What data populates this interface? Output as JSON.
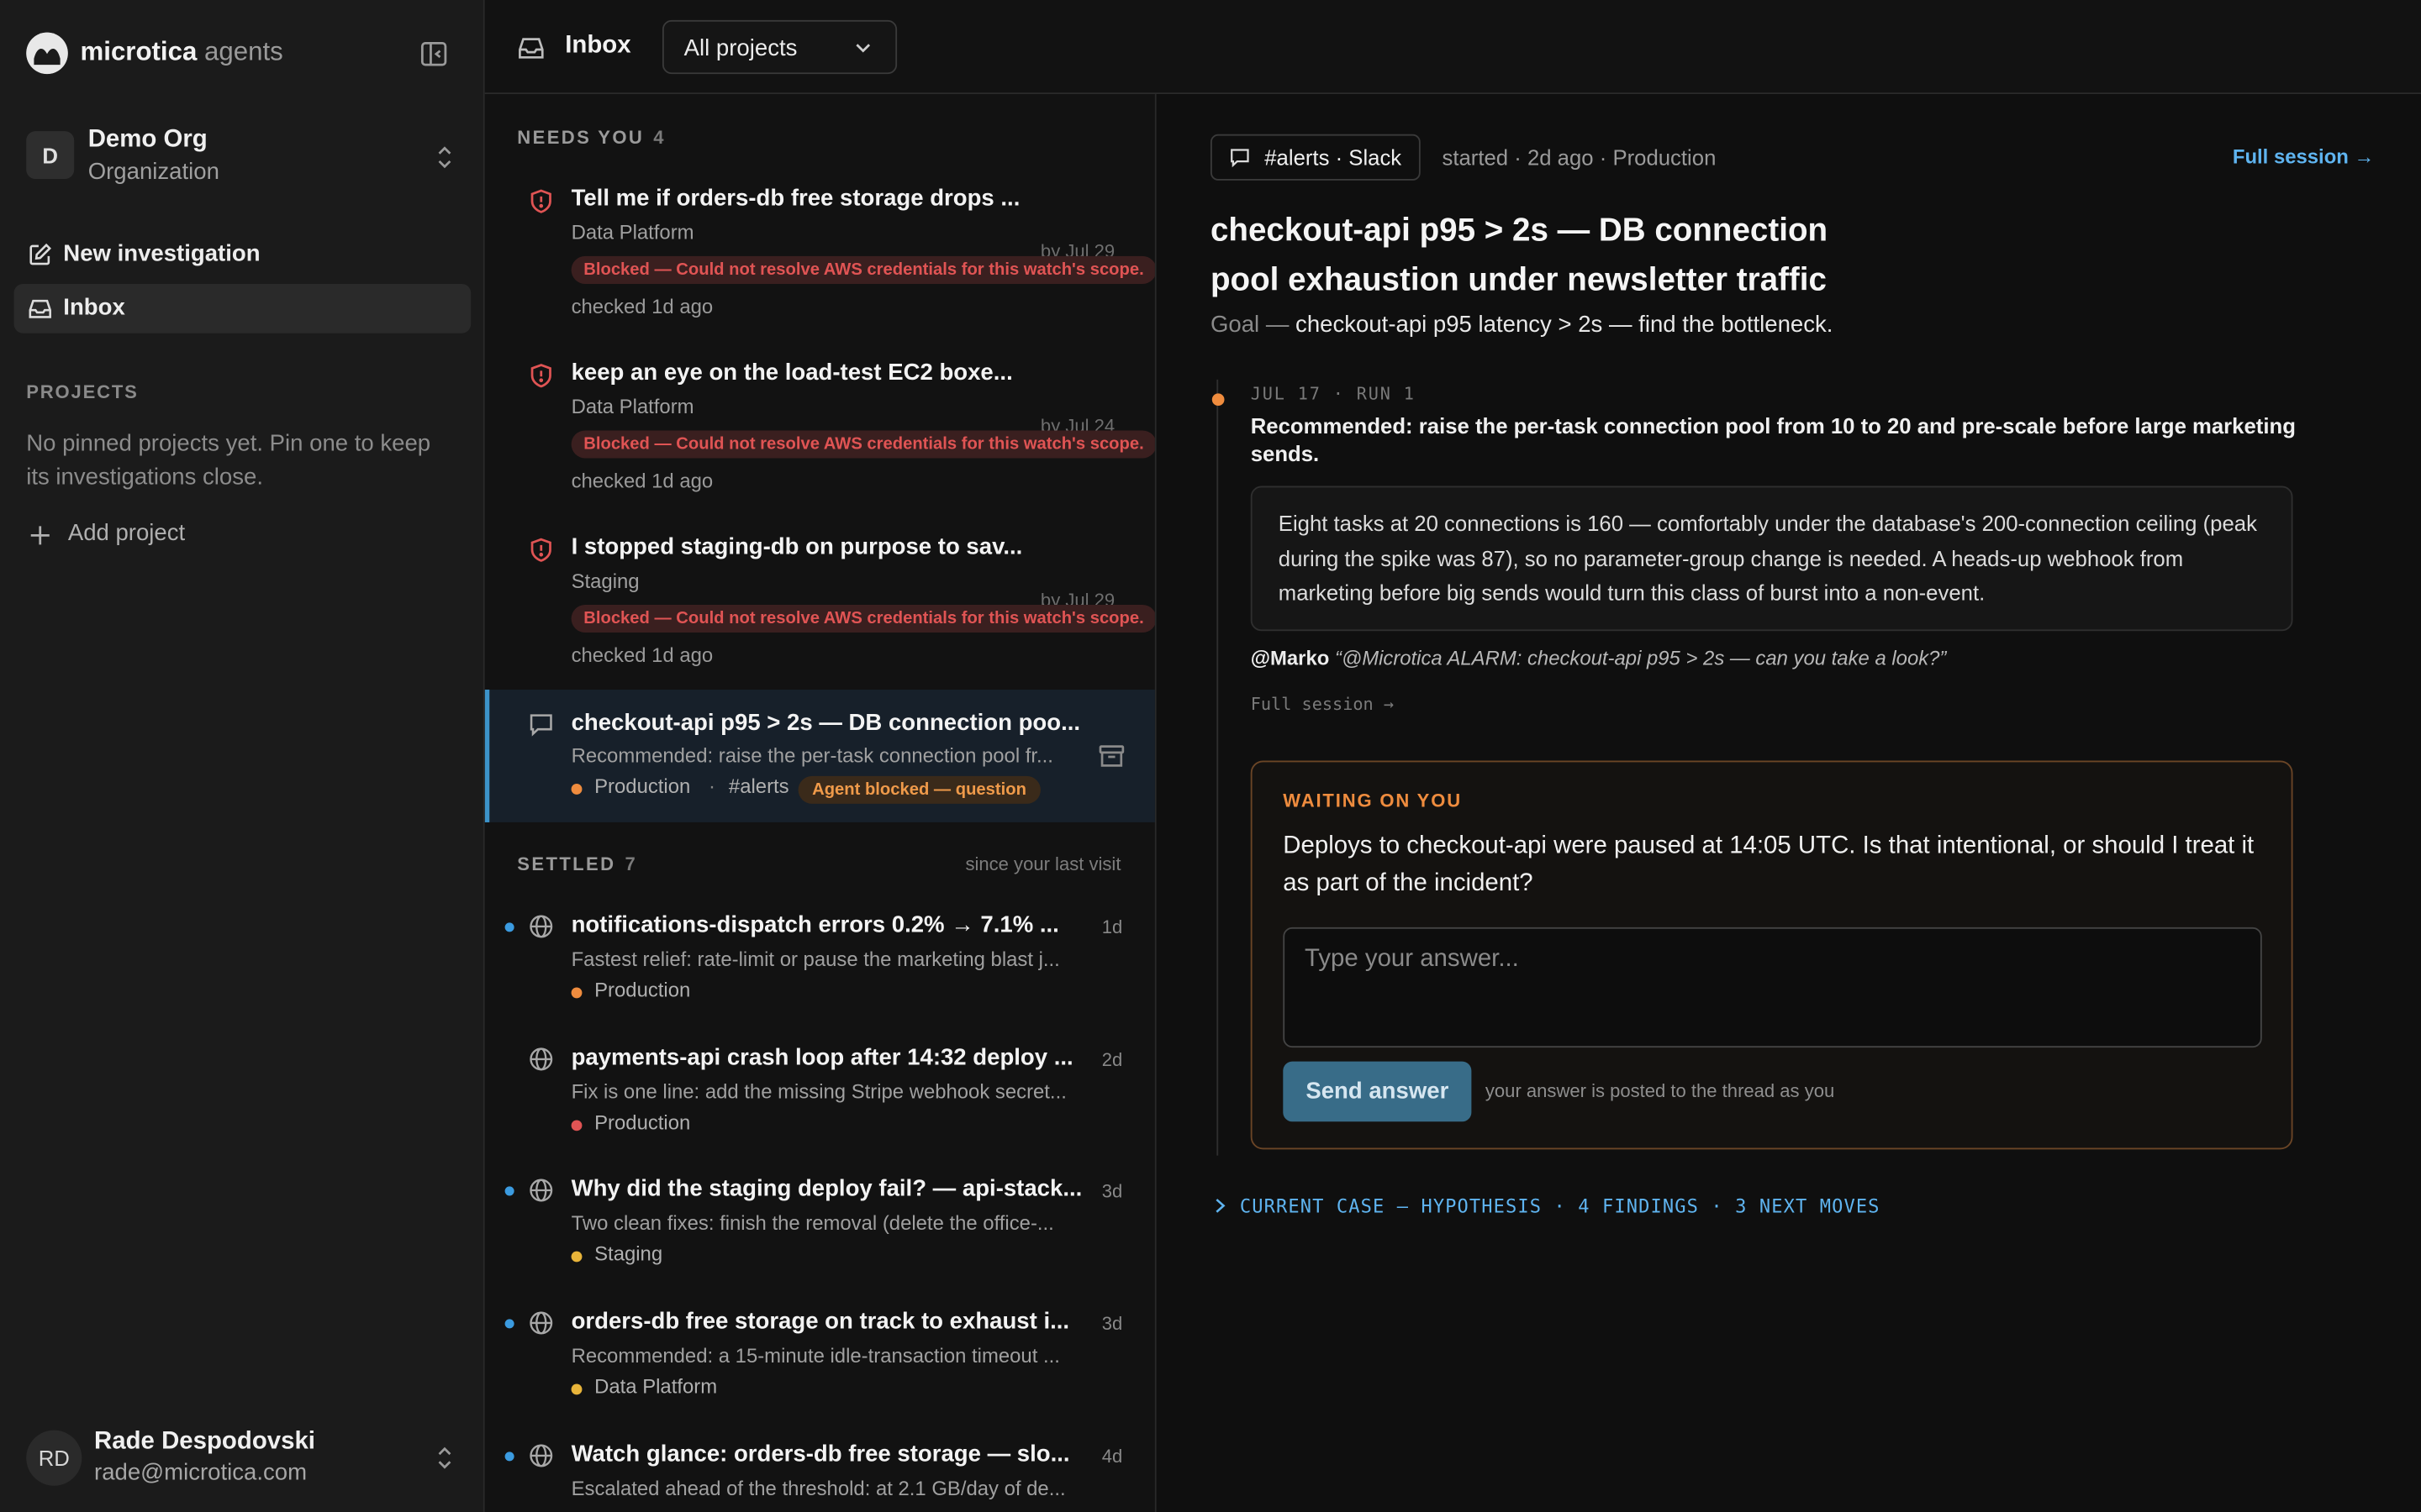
{
  "app": {
    "brand": "microtica",
    "brand_sub": "agents"
  },
  "org": {
    "initial": "D",
    "name": "Demo Org",
    "type": "Organization"
  },
  "nav": {
    "new_investigation": "New investigation",
    "inbox": "Inbox"
  },
  "projects": {
    "label": "PROJECTS",
    "empty": "No pinned projects yet. Pin one to keep its investigations close.",
    "add": "Add project"
  },
  "user": {
    "initials": "RD",
    "name": "Rade Despodovski",
    "email": "rade@microtica.com"
  },
  "topbar": {
    "title": "Inbox",
    "project_filter": "All projects"
  },
  "needs_you": {
    "label": "NEEDS YOU",
    "count": "4",
    "items": [
      {
        "title": "Tell me if orders-db free storage drops ...",
        "sub": "Data Platform",
        "by": "by Jul 29",
        "blocked": "Blocked — Could not resolve AWS credentials for this watch's scope.",
        "checked": "checked 1d ago"
      },
      {
        "title": "keep an eye on the load-test EC2 boxe...",
        "sub": "Data Platform",
        "by": "by Jul 24",
        "blocked": "Blocked — Could not resolve AWS credentials for this watch's scope.",
        "checked": "checked 1d ago"
      },
      {
        "title": "I stopped staging-db on purpose to sav...",
        "sub": "Staging",
        "by": "by Jul 29",
        "blocked": "Blocked — Could not resolve AWS credentials for this watch's scope.",
        "checked": "checked 1d ago"
      }
    ],
    "selected": {
      "title": "checkout-api p95 > 2s — DB connection poo...",
      "sub": "Recommended: raise the per-task connection pool fr...",
      "project": "Production",
      "sep": "·",
      "channel": "#alerts",
      "badge": "Agent blocked — question"
    }
  },
  "settled": {
    "label": "SETTLED",
    "count": "7",
    "note": "since your last visit",
    "items": [
      {
        "title": "notifications-dispatch errors 0.2% → 7.1% ...",
        "sub": "Fastest relief: rate-limit or pause the marketing blast j...",
        "project": "Production",
        "age": "1d"
      },
      {
        "title": "payments-api crash loop after 14:32 deploy ...",
        "sub": "Fix is one line: add the missing Stripe webhook secret...",
        "project": "Production",
        "age": "2d"
      },
      {
        "title": "Why did the staging deploy fail? — api-stack...",
        "sub": "Two clean fixes: finish the removal (delete the office-...",
        "project": "Staging",
        "age": "3d"
      },
      {
        "title": "orders-db free storage on track to exhaust i...",
        "sub": "Recommended: a 15-minute idle-transaction timeout ...",
        "project": "Data Platform",
        "age": "3d"
      },
      {
        "title": "Watch glance: orders-db free storage — slo...",
        "sub": "Escalated ahead of the threshold: at 2.1 GB/day of de...",
        "project": "",
        "age": "4d"
      }
    ]
  },
  "detail": {
    "channel": "#alerts · Slack",
    "started": "started · 2d ago · Production",
    "full_session": "Full session →",
    "title": "checkout-api p95 > 2s — DB connection pool exhaustion under newsletter traffic",
    "goal_prefix": "Goal —",
    "goal": "checkout-api p95 latency > 2s — find the bottleneck.",
    "run_label": "JUL 17 · RUN 1",
    "recommendation": "Recommended: raise the per-task connection pool from 10 to 20 and pre-scale before large marketing sends.",
    "explanation": "Eight tasks at 20 connections is 160 — comfortably under the database's 200-connection ceiling (peak during the spike was 87), so no parameter-group change is needed. A heads-up webhook from marketing before big sends would turn this class of burst into a non-event.",
    "quote_author": "@Marko",
    "quote": "“@Microtica ALARM: checkout-api p95 > 2s — can you take a look?”",
    "full_session_small": "Full session →",
    "waiting_label": "WAITING ON YOU",
    "question": "Deploys to checkout-api were paused at 14:05 UTC. Is that intentional, or should I treat it as part of the incident?",
    "answer_placeholder": "Type your answer...",
    "send_label": "Send answer",
    "send_note": "your answer is posted to the thread as you",
    "current_case": "CURRENT CASE — HYPOTHESIS · 4 FINDINGS · 3 NEXT MOVES"
  },
  "colors": {
    "accent_blue": "#5fb4f0",
    "warning_orange": "#ef8c3e",
    "blocked_red": "#e05454",
    "production_dot": "#ef8c3e",
    "staging_dot": "#e8b43a",
    "data_platform_dot": "#e8b43a",
    "unread_dot": "#3b9be0"
  }
}
